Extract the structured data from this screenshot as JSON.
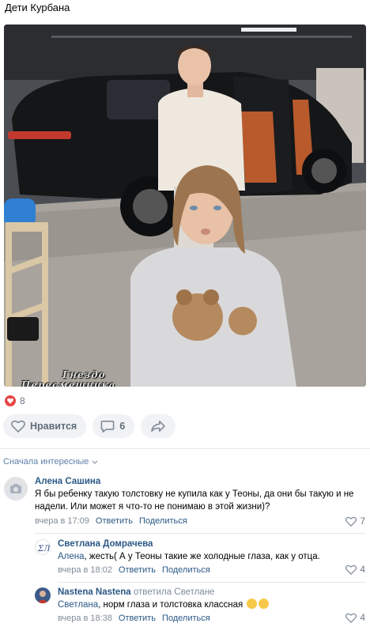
{
  "post": {
    "title": "Дети Курбана",
    "watermark_line1": "Гнездо",
    "watermark_line2": "Пересмешника",
    "like_count_summary": "8",
    "like_button_label": "Нравится",
    "comments_count": "6",
    "heart_color": "#e64646"
  },
  "comments_sort": {
    "label": "Сначала интересные"
  },
  "comments": [
    {
      "author": "Алена Сашина",
      "text": "Я бы ребенку такую толстовку не купила как у Теоны, да они бы такую и не надели. Или может я что-то не понимаю в этой жизни)?",
      "time": "вчера в 17:09",
      "reply_label": "Ответить",
      "share_label": "Поделиться",
      "likes": "7"
    },
    {
      "author": "Светлана Домрачева",
      "reply_to": "Алена",
      "text": ", жесть( А у Теоны такие же холодные глаза, как у отца.",
      "time": "вчера в 18:02",
      "reply_label": "Ответить",
      "share_label": "Поделиться",
      "likes": "4"
    },
    {
      "author": "Nastena Nastena",
      "replied_to_label": "ответила Светлане",
      "reply_to": "Светлана",
      "text": ", норм глаза и толстовка классная",
      "time": "вчера в 18:38",
      "reply_label": "Ответить",
      "share_label": "Поделиться",
      "likes": "4"
    }
  ]
}
